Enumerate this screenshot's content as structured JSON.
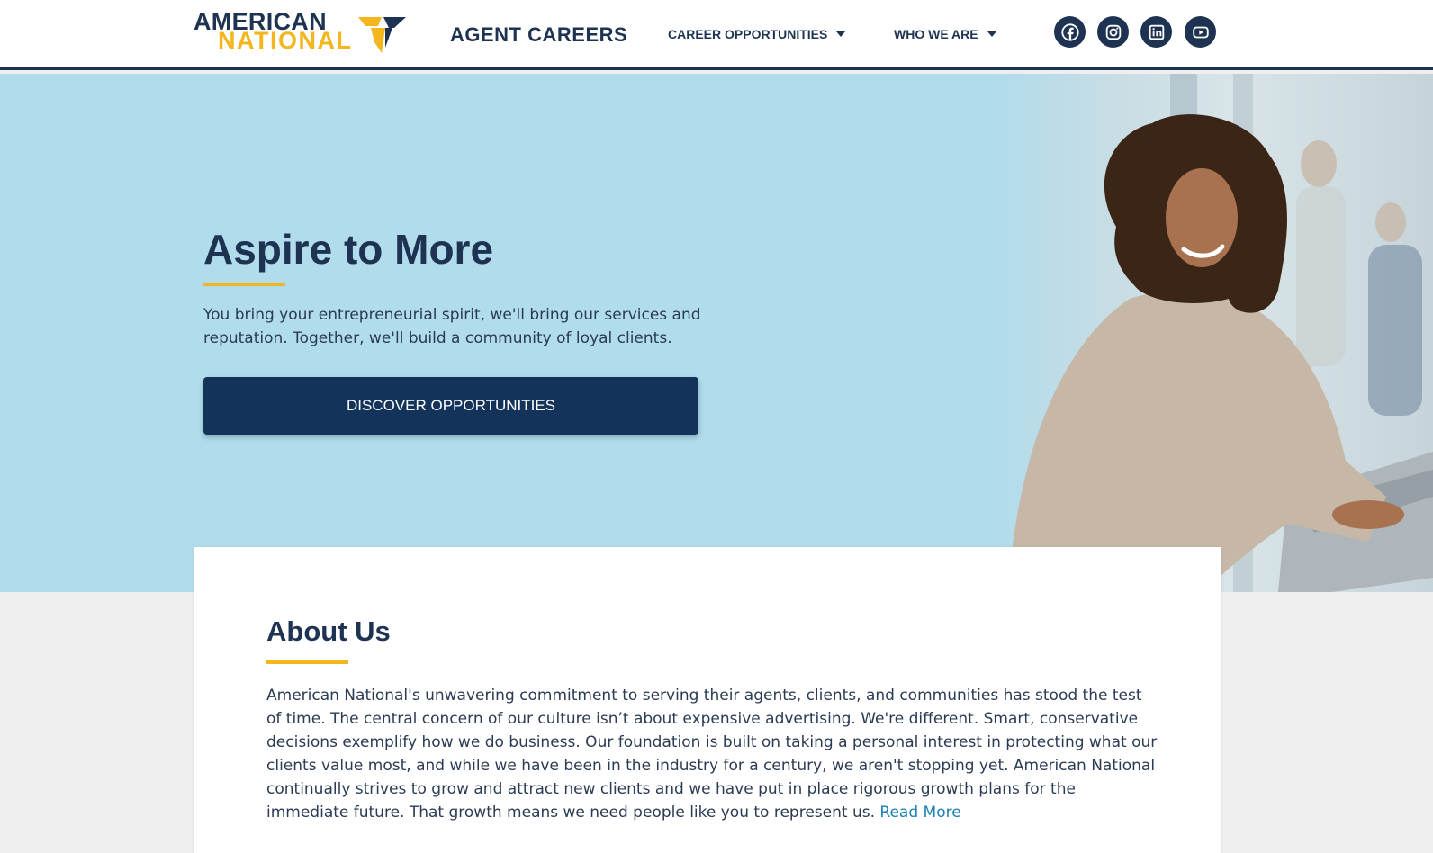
{
  "header": {
    "logo": {
      "line1": "AMERICAN",
      "line2": "NATIONAL"
    },
    "title": "AGENT CAREERS",
    "nav": [
      {
        "label": "CAREER OPPORTUNITIES"
      },
      {
        "label": "WHO WE ARE"
      }
    ],
    "social": [
      {
        "icon": "facebook-icon"
      },
      {
        "icon": "instagram-icon"
      },
      {
        "icon": "linkedin-icon"
      },
      {
        "icon": "youtube-icon"
      }
    ]
  },
  "hero": {
    "title": "Aspire to More",
    "text": "You bring your entrepreneurial spirit, we'll bring our services and reputation. Together, we'll build a community of loyal clients.",
    "cta": "DISCOVER OPPORTUNITIES"
  },
  "about": {
    "title": "About Us",
    "text": "American National's unwavering commitment to serving their agents, clients, and communities has stood the test of time. The central concern of our culture isn’t about expensive advertising. We're different. Smart, conservative decisions exemplify how we do business. Our foundation is built on taking a personal interest in protecting what our clients value most, and while we have been in the industry for a century, we aren't stopping yet. American National continually strives to grow and attract new clients and we have put in place rigorous growth plans for the immediate future. That growth means we need people like you to represent us.",
    "link": "Read More"
  },
  "colors": {
    "navy": "#1e3352",
    "gold": "#f3b61c",
    "hero_bg": "#b0dcec",
    "button": "#14335a",
    "link": "#1b7fb4"
  }
}
